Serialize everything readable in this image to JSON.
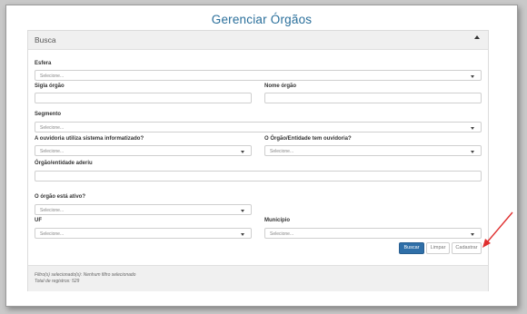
{
  "page": {
    "title": "Gerenciar Órgãos"
  },
  "busca": {
    "title": "Busca"
  },
  "fields": {
    "esfera": {
      "label": "Esfera",
      "placeholder": "Selecione..."
    },
    "sigla": {
      "label": "Sigla órgão"
    },
    "nome": {
      "label": "Nome órgão"
    },
    "segmento": {
      "label": "Segmento",
      "placeholder": "Selecione..."
    },
    "sistema": {
      "label": "A ouvidoria utiliza sistema informatizado?",
      "placeholder": "Selecione..."
    },
    "tem_ouvidoria": {
      "label": "O Órgão/Entidade tem ouvidoria?",
      "placeholder": "Selecione..."
    },
    "aderiu": {
      "label": "Órgão/entidade aderiu"
    },
    "ativo": {
      "label": "O órgão está ativo?",
      "placeholder": "Selecione..."
    },
    "uf": {
      "label": "UF",
      "placeholder": "Selecione..."
    },
    "municipio": {
      "label": "Município",
      "placeholder": "Selecione..."
    }
  },
  "buttons": {
    "buscar": "Buscar",
    "limpar": "Limpar",
    "cadastrar": "Cadastrar"
  },
  "footer": {
    "filters": "Filtro(s) selecionado(s): Nenhum filtro selecionado",
    "total": "Total de registros: 529"
  },
  "colors": {
    "title": "#2a6f9b",
    "primary": "#2f6fa8",
    "annotation_arrow": "#e03030"
  }
}
